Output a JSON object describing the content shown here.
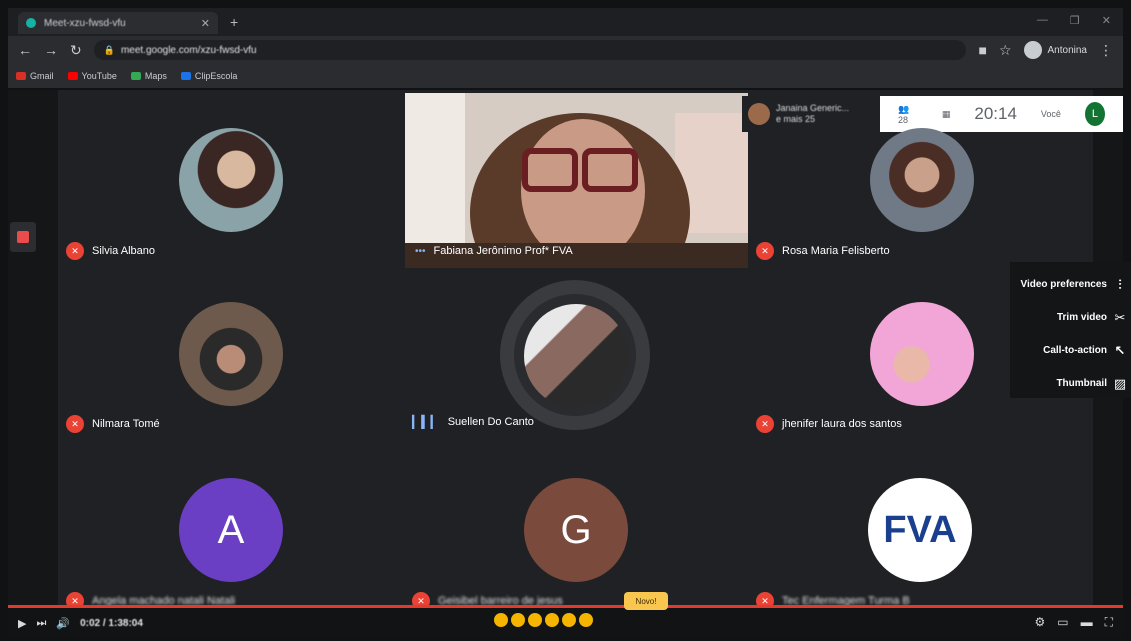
{
  "browser": {
    "tab_title": "Meet-xzu-fwsd-vfu",
    "url": "meet.google.com/xzu-fwsd-vfu",
    "profile_name": "Antonina",
    "bookmarks": [
      {
        "label": "Gmail",
        "color": "#d93025"
      },
      {
        "label": "YouTube",
        "color": "#ff0000"
      },
      {
        "label": "Maps",
        "color": "#34a853"
      },
      {
        "label": "ClipEscola",
        "color": "#1a73e8"
      }
    ]
  },
  "participants": [
    {
      "name": "Silvia Albano",
      "muted": true
    },
    {
      "name": "Fabiana Jerônimo Prof* FVA",
      "muted": false,
      "video": true
    },
    {
      "name": "Rosa Maria Felisberto",
      "muted": true
    },
    {
      "name": "Nilmara Tomé",
      "muted": true
    },
    {
      "name": "Suellen Do Canto",
      "muted": false,
      "speaking": true
    },
    {
      "name": "jhenifer laura dos santos",
      "muted": true
    },
    {
      "name": "Angela machado natali Natali",
      "muted": true,
      "initial": "A",
      "color": "#6a3fc4"
    },
    {
      "name": "Geisibel barreiro de jesus",
      "muted": true,
      "initial": "G",
      "color": "#7a4a3c"
    },
    {
      "name": "Tec Enfermagem Turma B",
      "muted": true,
      "logo_text": "FVA"
    }
  ],
  "top_info": {
    "line1": "Janaina Generic...",
    "line2": "e mais 25"
  },
  "meeting_bar": {
    "people_count": "28",
    "clock": "20:14",
    "me_label": "Você",
    "me_initial": "L"
  },
  "side_menu": [
    {
      "label": "Video preferences",
      "icon": "sliders-icon"
    },
    {
      "label": "Trim video",
      "icon": "scissors-icon"
    },
    {
      "label": "Call-to-action",
      "icon": "cursor-icon"
    },
    {
      "label": "Thumbnail",
      "icon": "image-icon"
    }
  ],
  "player": {
    "time": "0:02 / 1:38:04",
    "tooltip": "Novo!",
    "progress": 1.0
  },
  "colors": {
    "mute_red": "#ea4335",
    "meet_bg": "#202124",
    "accent_green": "#137333"
  }
}
